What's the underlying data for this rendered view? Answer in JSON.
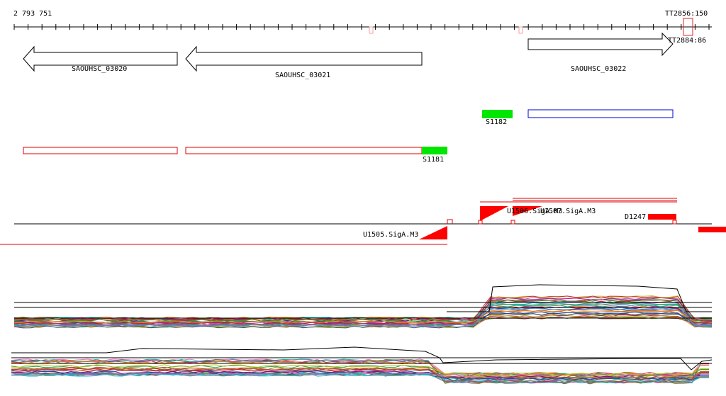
{
  "ruler": {
    "start_label": "2 793 751",
    "end_label": "TT2856:150"
  },
  "genes": [
    {
      "name": "SAOUHSC_03020",
      "strand": "-"
    },
    {
      "name": "SAOUHSC_03021",
      "strand": "-"
    },
    {
      "name": "SAOUHSC_03022",
      "strand": "+"
    }
  ],
  "terminator": {
    "label": "TT2884:86"
  },
  "segments": [
    {
      "label": "S1181",
      "color": "#00e600"
    },
    {
      "label": "S1182",
      "color": "#00e600"
    }
  ],
  "promoters": [
    {
      "label": "U1505.SigA.M3",
      "strand": "-"
    },
    {
      "label": "U1506.SigA.M3",
      "strand": "+"
    },
    {
      "label": "U1507.SigA.M3",
      "strand": "+"
    },
    {
      "label": "D1247",
      "strand": "+"
    }
  ],
  "colors": {
    "gene_outline": "#000000",
    "cds_red": "#e00000",
    "cds_blue": "#0000cc",
    "segment_green": "#00e600",
    "promoter_red": "#ff0000"
  }
}
